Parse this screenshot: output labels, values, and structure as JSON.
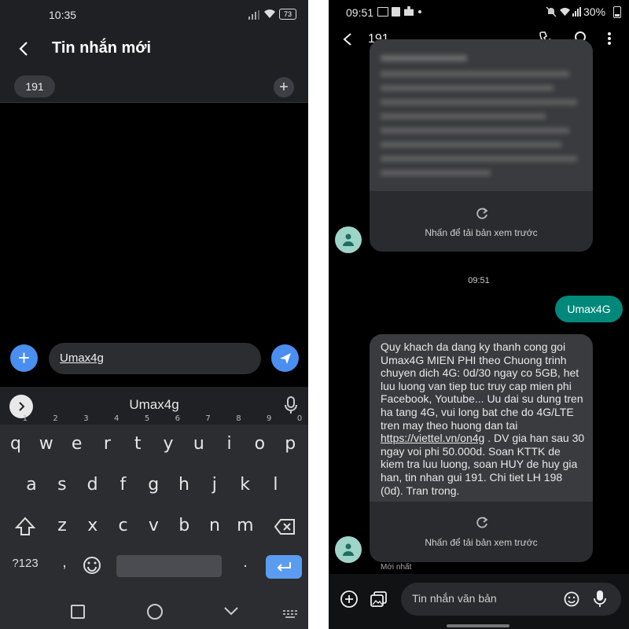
{
  "left": {
    "status": {
      "time": "10:35",
      "battery": "73"
    },
    "header": {
      "title": "Tin nhắn mới"
    },
    "recipient": {
      "chip": "191"
    },
    "compose": {
      "text": "Umax4g"
    },
    "keyboard": {
      "suggestion": "Umax4g",
      "row1": [
        {
          "k": "q",
          "n": "1"
        },
        {
          "k": "w",
          "n": "2"
        },
        {
          "k": "e",
          "n": "3"
        },
        {
          "k": "r",
          "n": "4"
        },
        {
          "k": "t",
          "n": "5"
        },
        {
          "k": "y",
          "n": "6"
        },
        {
          "k": "u",
          "n": "7"
        },
        {
          "k": "i",
          "n": "8"
        },
        {
          "k": "o",
          "n": "9"
        },
        {
          "k": "p",
          "n": "0"
        }
      ],
      "row2": [
        "a",
        "s",
        "d",
        "f",
        "g",
        "h",
        "j",
        "k",
        "l"
      ],
      "row3": [
        "z",
        "x",
        "c",
        "v",
        "b",
        "n",
        "m"
      ],
      "sym": "?123",
      "comma": ",",
      "period": "."
    }
  },
  "right": {
    "status": {
      "time": "09:51",
      "battery": "30%"
    },
    "header": {
      "title": "191"
    },
    "time_divider": "09:51",
    "sent": "Umax4G",
    "reload_label": "Nhấn để tải bản xem trước",
    "received": {
      "before_link": "Quy khach da dang ky thanh cong goi Umax4G MIEN PHI theo Chuong trinh chuyen dich 4G: 0d/30 ngay co 5GB, het luu luong van tiep tuc truy cap mien phi Facebook, Youtube... Uu dai su dung tren ha tang 4G, vui long bat che do 4G/LTE tren may theo huong dan tai ",
      "link": "https://viettel.vn/on4g",
      "after_link": " . DV gia han sau 30 ngay voi phi 50.000d. Soan KTTK de kiem tra luu luong, soan HUY de huy gia han, tin nhan gui 191. Chi tiet LH 198 (0d). Tran trong."
    },
    "latest": "Mới nhất",
    "input_placeholder": "Tin nhắn văn bản"
  },
  "colors": {
    "accent_blue": "#4a8ef0",
    "sent_bubble": "#00897b",
    "avatar": "#9fd4c9"
  }
}
